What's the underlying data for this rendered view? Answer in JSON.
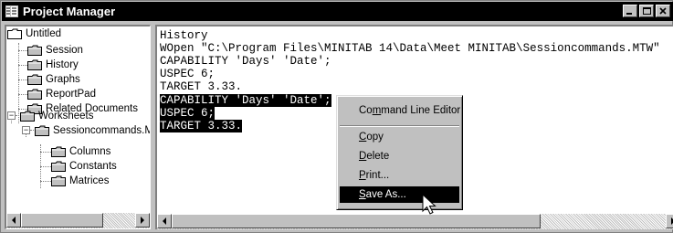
{
  "window": {
    "title": "Project Manager",
    "icon": "project-manager-icon"
  },
  "tree": {
    "root": "Untitled",
    "items": [
      "Session",
      "History",
      "Graphs",
      "ReportPad",
      "Related Documents"
    ],
    "worksheets": {
      "label": "Worksheets",
      "children": [
        {
          "label": "Sessioncommands.MTW",
          "children": [
            "Columns",
            "Constants",
            "Matrices"
          ]
        }
      ]
    }
  },
  "history": {
    "header": "History",
    "lines": [
      "WOpen \"C:\\Program Files\\MINITAB 14\\Data\\Meet MINITAB\\Sessioncommands.MTW\"",
      "CAPABILITY 'Days' 'Date';",
      "USPEC 6;",
      "TARGET 3.33.",
      "CAPABILITY 'Days' 'Date';",
      "USPEC 6;",
      "TARGET 3.33."
    ],
    "selected_lines": [
      4,
      5,
      6
    ]
  },
  "context_menu": {
    "items": [
      {
        "pre": "Co",
        "u": "m",
        "post": "mand Line Editor"
      },
      {
        "pre": "",
        "u": "C",
        "post": "opy"
      },
      {
        "pre": "",
        "u": "D",
        "post": "elete"
      },
      {
        "pre": "",
        "u": "P",
        "post": "rint..."
      },
      {
        "pre": "",
        "u": "S",
        "post": "ave As..."
      }
    ],
    "highlighted": "Save As..."
  },
  "colors": {
    "titlebar": "#000000",
    "face": "#c0c0c0",
    "selection": "#000000"
  }
}
